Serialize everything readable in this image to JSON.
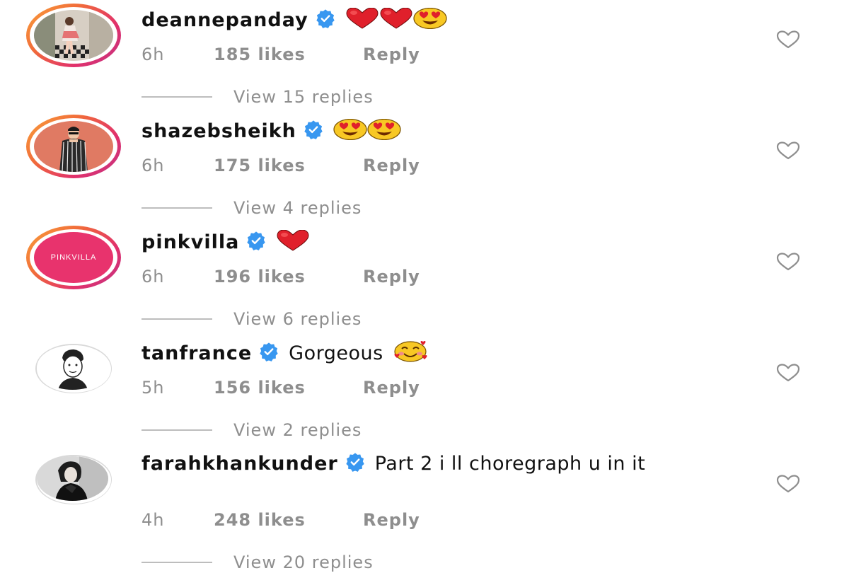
{
  "colors": {
    "accent": "#3897f0",
    "muted": "#8e8e8e",
    "heart": "#ed2f3f"
  },
  "comments": [
    {
      "username": "deannepanday",
      "text": "",
      "emojis": [
        "red-heart",
        "red-heart",
        "heart-eyes"
      ],
      "time": "6h",
      "likes": "185 likes",
      "reply": "Reply",
      "view_replies": "View 15 replies",
      "avatar": "photo-woman-tiles",
      "ring": true
    },
    {
      "username": "shazebsheikh",
      "text": "",
      "emojis": [
        "heart-eyes",
        "heart-eyes"
      ],
      "time": "6h",
      "likes": "175 likes",
      "reply": "Reply",
      "view_replies": "View 4 replies",
      "avatar": "illustration-man-orange",
      "ring": true
    },
    {
      "username": "pinkvilla",
      "text": "",
      "emojis": [
        "red-heart"
      ],
      "time": "6h",
      "likes": "196 likes",
      "reply": "Reply",
      "view_replies": "View 6 replies",
      "avatar": "pinkvilla-logo",
      "avatar_label": "PINKVILLA",
      "ring": true
    },
    {
      "username": "tanfrance",
      "text": "Gorgeous",
      "emojis": [
        "smiling-hearts"
      ],
      "time": "5h",
      "likes": "156 likes",
      "reply": "Reply",
      "view_replies": "View 2 replies",
      "avatar": "sketch-man",
      "ring": false
    },
    {
      "username": "farahkhankunder",
      "text": "Part 2 i ll choregraph u in it",
      "emojis": [],
      "time": "4h",
      "likes": "248 likes",
      "reply": "Reply",
      "view_replies": "View 20 replies",
      "avatar": "photo-woman-bw",
      "ring": false
    }
  ]
}
